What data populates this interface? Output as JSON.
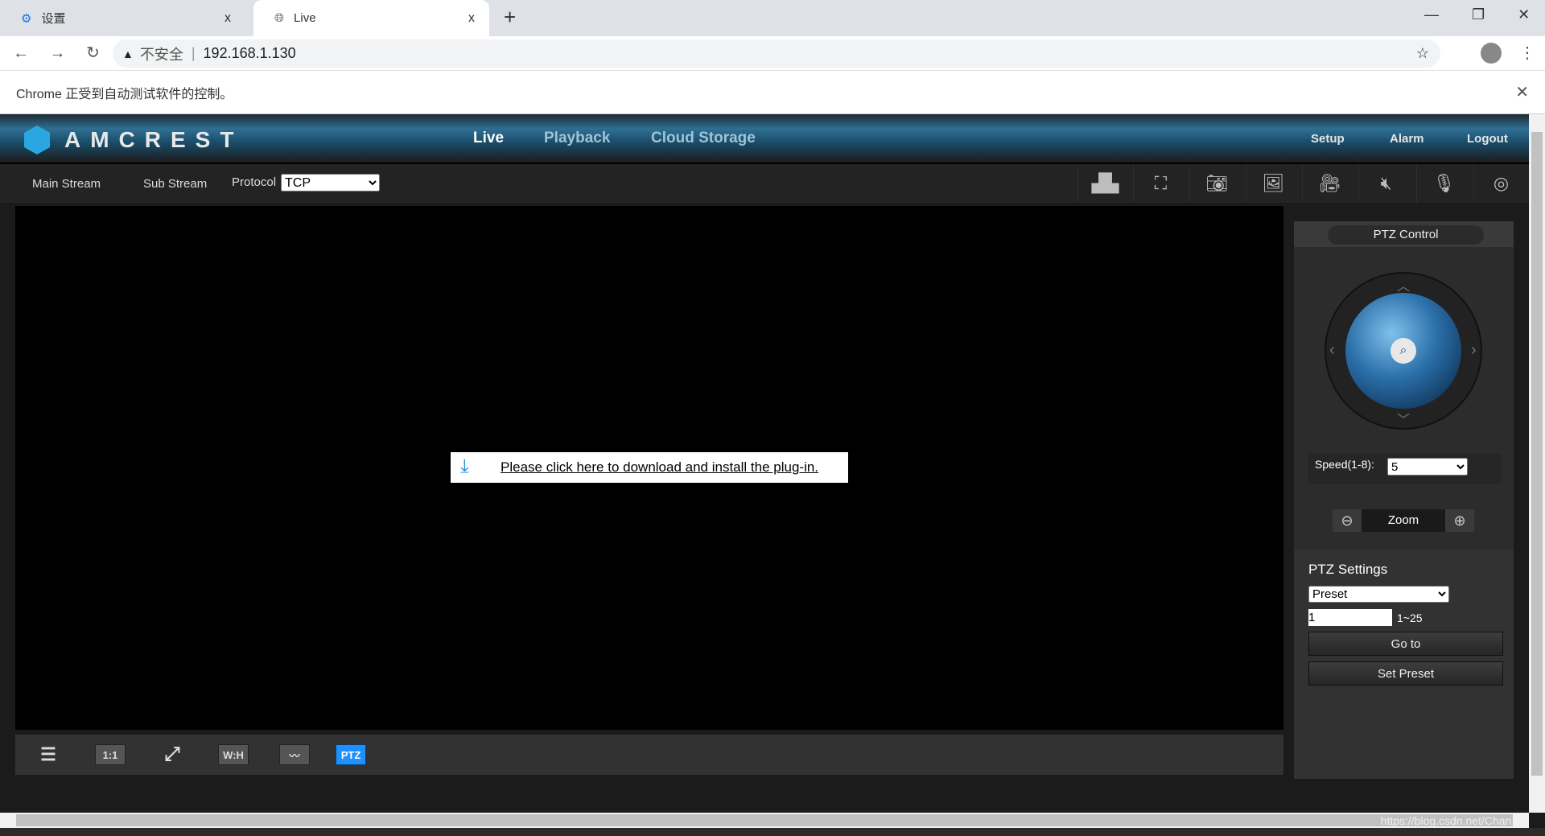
{
  "browser": {
    "tabs": [
      {
        "title": "设置",
        "icon": "gear-icon"
      },
      {
        "title": "Live",
        "icon": "globe-icon"
      }
    ],
    "new_tab": "+",
    "close": "x",
    "security": "不安全",
    "url": "192.168.1.130",
    "info_bar": "Chrome 正受到自动测试软件的控制。"
  },
  "app": {
    "logo": "AMCREST",
    "nav": [
      "Live",
      "Playback",
      "Cloud Storage"
    ],
    "right_nav": [
      "Setup",
      "Alarm",
      "Logout"
    ],
    "streams": [
      "Main Stream",
      "Sub Stream"
    ],
    "protocol_label": "Protocol",
    "protocol_value": "TCP",
    "toolbar_icons": [
      "alarm-light-icon",
      "region-zoom-icon",
      "snapshot-icon",
      "triple-snapshot-icon",
      "record-icon",
      "audio-mute-icon",
      "microphone-icon",
      "fisheye-icon"
    ],
    "plugin_message": "Please click here to download and install the plug-in.",
    "bottom_buttons": [
      "adjust",
      "1:1",
      "fullscreen",
      "W:H",
      "fluency",
      "PTZ"
    ],
    "accent": "#1e90ff"
  },
  "ptz": {
    "title": "PTZ Control",
    "speed_label": "Speed(1-8):",
    "speed_value": "5",
    "zoom_label": "Zoom",
    "settings_title": "PTZ Settings",
    "mode": "Preset",
    "preset_value": "1",
    "preset_range": "1~25",
    "goto": "Go to",
    "set_preset": "Set Preset"
  },
  "watermark": "https://blog.csdn.net/Chan..."
}
